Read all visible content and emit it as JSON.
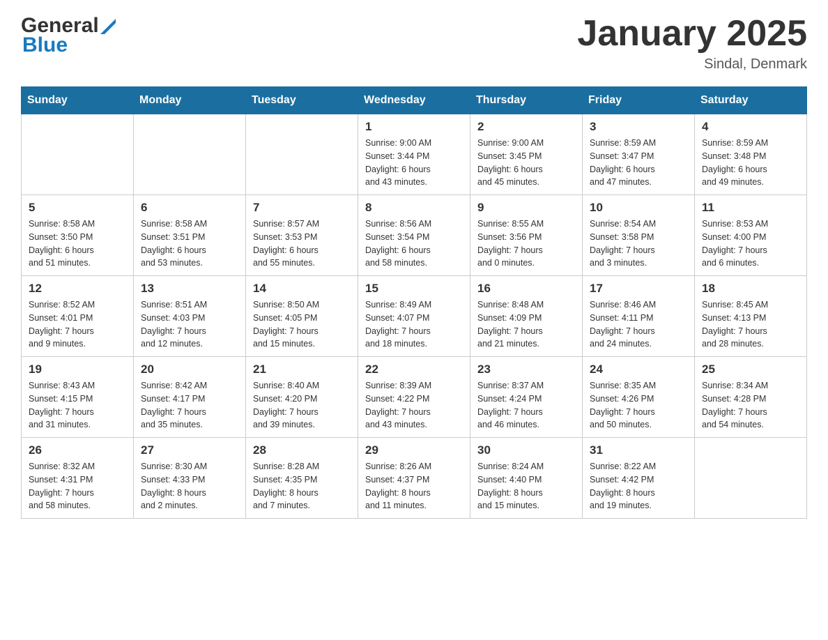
{
  "header": {
    "logo_general": "General",
    "logo_blue": "Blue",
    "title": "January 2025",
    "subtitle": "Sindal, Denmark"
  },
  "days_of_week": [
    "Sunday",
    "Monday",
    "Tuesday",
    "Wednesday",
    "Thursday",
    "Friday",
    "Saturday"
  ],
  "weeks": [
    [
      {
        "day": "",
        "info": ""
      },
      {
        "day": "",
        "info": ""
      },
      {
        "day": "",
        "info": ""
      },
      {
        "day": "1",
        "info": "Sunrise: 9:00 AM\nSunset: 3:44 PM\nDaylight: 6 hours\nand 43 minutes."
      },
      {
        "day": "2",
        "info": "Sunrise: 9:00 AM\nSunset: 3:45 PM\nDaylight: 6 hours\nand 45 minutes."
      },
      {
        "day": "3",
        "info": "Sunrise: 8:59 AM\nSunset: 3:47 PM\nDaylight: 6 hours\nand 47 minutes."
      },
      {
        "day": "4",
        "info": "Sunrise: 8:59 AM\nSunset: 3:48 PM\nDaylight: 6 hours\nand 49 minutes."
      }
    ],
    [
      {
        "day": "5",
        "info": "Sunrise: 8:58 AM\nSunset: 3:50 PM\nDaylight: 6 hours\nand 51 minutes."
      },
      {
        "day": "6",
        "info": "Sunrise: 8:58 AM\nSunset: 3:51 PM\nDaylight: 6 hours\nand 53 minutes."
      },
      {
        "day": "7",
        "info": "Sunrise: 8:57 AM\nSunset: 3:53 PM\nDaylight: 6 hours\nand 55 minutes."
      },
      {
        "day": "8",
        "info": "Sunrise: 8:56 AM\nSunset: 3:54 PM\nDaylight: 6 hours\nand 58 minutes."
      },
      {
        "day": "9",
        "info": "Sunrise: 8:55 AM\nSunset: 3:56 PM\nDaylight: 7 hours\nand 0 minutes."
      },
      {
        "day": "10",
        "info": "Sunrise: 8:54 AM\nSunset: 3:58 PM\nDaylight: 7 hours\nand 3 minutes."
      },
      {
        "day": "11",
        "info": "Sunrise: 8:53 AM\nSunset: 4:00 PM\nDaylight: 7 hours\nand 6 minutes."
      }
    ],
    [
      {
        "day": "12",
        "info": "Sunrise: 8:52 AM\nSunset: 4:01 PM\nDaylight: 7 hours\nand 9 minutes."
      },
      {
        "day": "13",
        "info": "Sunrise: 8:51 AM\nSunset: 4:03 PM\nDaylight: 7 hours\nand 12 minutes."
      },
      {
        "day": "14",
        "info": "Sunrise: 8:50 AM\nSunset: 4:05 PM\nDaylight: 7 hours\nand 15 minutes."
      },
      {
        "day": "15",
        "info": "Sunrise: 8:49 AM\nSunset: 4:07 PM\nDaylight: 7 hours\nand 18 minutes."
      },
      {
        "day": "16",
        "info": "Sunrise: 8:48 AM\nSunset: 4:09 PM\nDaylight: 7 hours\nand 21 minutes."
      },
      {
        "day": "17",
        "info": "Sunrise: 8:46 AM\nSunset: 4:11 PM\nDaylight: 7 hours\nand 24 minutes."
      },
      {
        "day": "18",
        "info": "Sunrise: 8:45 AM\nSunset: 4:13 PM\nDaylight: 7 hours\nand 28 minutes."
      }
    ],
    [
      {
        "day": "19",
        "info": "Sunrise: 8:43 AM\nSunset: 4:15 PM\nDaylight: 7 hours\nand 31 minutes."
      },
      {
        "day": "20",
        "info": "Sunrise: 8:42 AM\nSunset: 4:17 PM\nDaylight: 7 hours\nand 35 minutes."
      },
      {
        "day": "21",
        "info": "Sunrise: 8:40 AM\nSunset: 4:20 PM\nDaylight: 7 hours\nand 39 minutes."
      },
      {
        "day": "22",
        "info": "Sunrise: 8:39 AM\nSunset: 4:22 PM\nDaylight: 7 hours\nand 43 minutes."
      },
      {
        "day": "23",
        "info": "Sunrise: 8:37 AM\nSunset: 4:24 PM\nDaylight: 7 hours\nand 46 minutes."
      },
      {
        "day": "24",
        "info": "Sunrise: 8:35 AM\nSunset: 4:26 PM\nDaylight: 7 hours\nand 50 minutes."
      },
      {
        "day": "25",
        "info": "Sunrise: 8:34 AM\nSunset: 4:28 PM\nDaylight: 7 hours\nand 54 minutes."
      }
    ],
    [
      {
        "day": "26",
        "info": "Sunrise: 8:32 AM\nSunset: 4:31 PM\nDaylight: 7 hours\nand 58 minutes."
      },
      {
        "day": "27",
        "info": "Sunrise: 8:30 AM\nSunset: 4:33 PM\nDaylight: 8 hours\nand 2 minutes."
      },
      {
        "day": "28",
        "info": "Sunrise: 8:28 AM\nSunset: 4:35 PM\nDaylight: 8 hours\nand 7 minutes."
      },
      {
        "day": "29",
        "info": "Sunrise: 8:26 AM\nSunset: 4:37 PM\nDaylight: 8 hours\nand 11 minutes."
      },
      {
        "day": "30",
        "info": "Sunrise: 8:24 AM\nSunset: 4:40 PM\nDaylight: 8 hours\nand 15 minutes."
      },
      {
        "day": "31",
        "info": "Sunrise: 8:22 AM\nSunset: 4:42 PM\nDaylight: 8 hours\nand 19 minutes."
      },
      {
        "day": "",
        "info": ""
      }
    ]
  ]
}
